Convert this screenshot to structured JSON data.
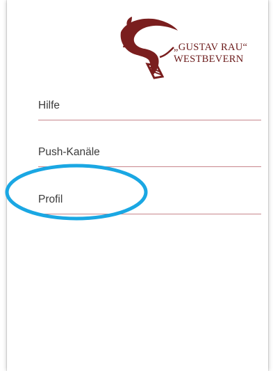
{
  "logo": {
    "line1": "„GUSTAV RAU“",
    "line2": "WESTBEVERN",
    "brand_color": "#6b1a1a"
  },
  "menu": {
    "items": [
      {
        "label": "Hilfe"
      },
      {
        "label": "Push-Kanäle"
      },
      {
        "label": "Profil"
      }
    ],
    "divider_color": "#c7868b"
  },
  "annotation": {
    "highlight_color": "#1aa7e3",
    "highlighted_item": "Profil"
  }
}
